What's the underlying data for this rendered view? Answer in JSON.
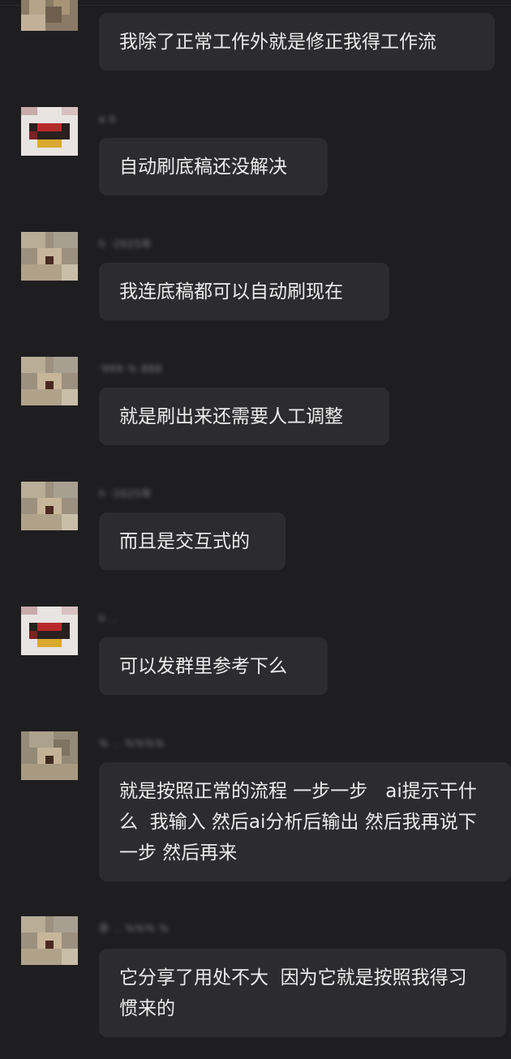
{
  "messages": [
    {
      "sender": "",
      "text": "我除了正常工作外就是修正我得工作流",
      "avatar": "photo-avatar"
    },
    {
      "sender": "a b",
      "text": "自动刷底稿还没解决",
      "avatar": "cartoon-avatar"
    },
    {
      "sender": "h ·2025年",
      "text": "我连底稿都可以自动刷现在",
      "avatar": "photo-avatar"
    },
    {
      "sender": "'999 % 888",
      "text": "就是刷出来还需要人工调整",
      "avatar": "photo-avatar"
    },
    {
      "sender": "h ·2025年",
      "text": "而且是交互式的",
      "avatar": "photo-avatar"
    },
    {
      "sender": "h ..",
      "text": "可以发群里参考下么",
      "avatar": "cartoon-avatar"
    },
    {
      "sender": "% .. %%%%",
      "text": "就是按照正常的流程 一步一步   ai提示干什么  我输入 然后ai分析后输出 然后我再说下一步 然后再来",
      "avatar": "photo-avatar"
    },
    {
      "sender": "非 .. %%% %",
      "text": "它分享了用处不大  因为它就是按照我得习惯来的",
      "avatar": "photo-avatar"
    }
  ],
  "colors": {
    "background": "#1e1e20",
    "bubble": "#2c2c2e",
    "text": "#ececec",
    "sender": "#8a8a8e"
  }
}
